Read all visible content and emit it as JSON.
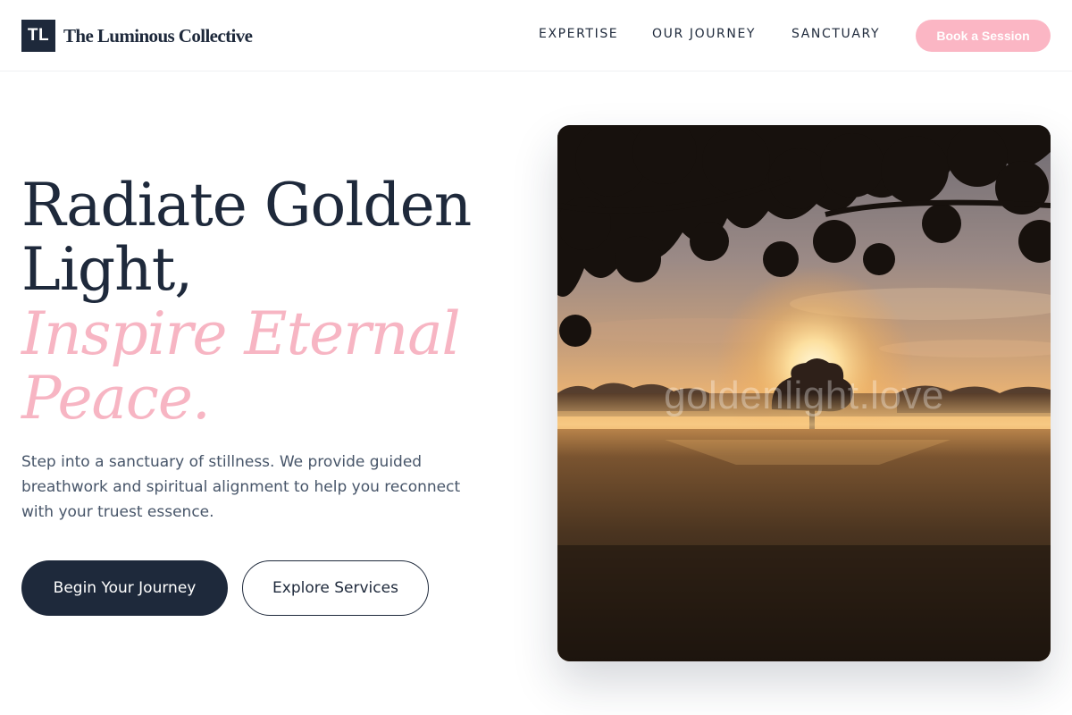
{
  "brand": {
    "mark": "TL",
    "name": "The Luminous Collective"
  },
  "nav": {
    "items": [
      {
        "label": "EXPERTISE"
      },
      {
        "label": "OUR JOURNEY"
      },
      {
        "label": "SANCTUARY"
      }
    ],
    "cta_label": "Book a Session"
  },
  "hero": {
    "headline_line1": "Radiate Golden",
    "headline_line2": "Light,",
    "headline_accent_line1": "Inspire Eternal",
    "headline_accent_line2": "Peace.",
    "lead": "Step into a sanctuary of stillness. We provide guided breathwork and spiritual alignment to help you reconnect with your truest essence.",
    "primary_button": "Begin Your Journey",
    "secondary_button": "Explore Services",
    "image": {
      "description_icon": "sunrise-meadow-photo",
      "watermark": "goldenlight.love"
    }
  },
  "colors": {
    "navy": "#1e293b",
    "pink_accent": "#f7b5c3",
    "cta_pink": "#fbb6c4",
    "body_text": "#475569"
  }
}
